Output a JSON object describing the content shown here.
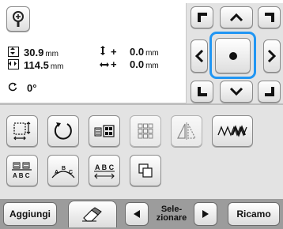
{
  "info": {
    "width_value": "30.9",
    "width_unit": "mm",
    "height_value": "114.5",
    "height_unit": "mm",
    "offset_v_sign": "+",
    "offset_v_value": "0.0",
    "offset_v_unit": "mm",
    "offset_h_sign": "+",
    "offset_h_value": "0.0",
    "offset_h_unit": "mm",
    "rotation_value": "0°"
  },
  "icons": {
    "zoom": "zoom-icon",
    "center": "center-dot-icon"
  },
  "footer": {
    "add_label": "Aggiungi",
    "select_label_line1": "Sele-",
    "select_label_line2": "zionare",
    "embroider_label": "Ricamo"
  },
  "colors": {
    "highlight": "#2196f3",
    "footer_bg": "#9c9c9c"
  }
}
